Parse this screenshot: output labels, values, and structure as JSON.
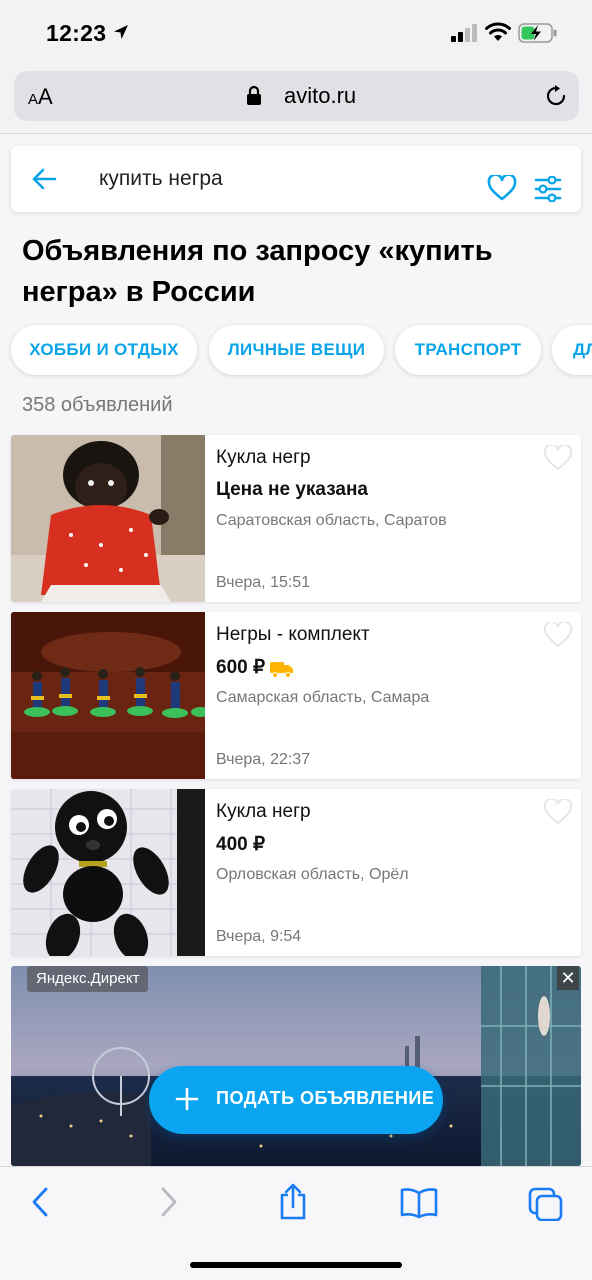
{
  "status_bar": {
    "time": "12:23"
  },
  "browser": {
    "text_size_label_small": "A",
    "text_size_label_large": "A",
    "domain": "avito.ru"
  },
  "search": {
    "query": "купить негра"
  },
  "headline": "Объявления по запросу «купить негра» в России",
  "categories": [
    "ХОББИ И ОТДЫХ",
    "ЛИЧНЫЕ ВЕЩИ",
    "ТРАНСПОРТ",
    "ДЛ"
  ],
  "results_count": "358 объявлений",
  "listings": [
    {
      "title": "Кукла негр",
      "price": "Цена не указана",
      "delivery": false,
      "location": "Саратовская область, Саратов",
      "date": "Вчера, 15:51"
    },
    {
      "title": "Негры - комплект",
      "price": "600 ₽",
      "delivery": true,
      "location": "Самарская область, Самара",
      "date": "Вчера, 22:37"
    },
    {
      "title": "Кукла негр",
      "price": "400 ₽",
      "delivery": false,
      "location": "Орловская область, Орёл",
      "date": "Вчера, 9:54"
    }
  ],
  "ad": {
    "badge": "Яндекс.Директ",
    "close": "✕"
  },
  "post_ad_button": "ПОДАТЬ ОБЪЯВЛЕНИЕ",
  "colors": {
    "accent": "#0aa4e8",
    "fab": "#0aa4f0",
    "delivery": "#ffb400",
    "ios_blue": "#1a7cf5"
  },
  "icons": [
    "location-arrow-icon",
    "signal-icon",
    "wifi-icon",
    "battery-charging-icon",
    "lock-icon",
    "reload-icon",
    "back-arrow-icon",
    "heart-icon",
    "filter-icon",
    "truck-icon",
    "plus-icon",
    "chevron-left-icon",
    "chevron-right-icon",
    "share-icon",
    "bookmarks-icon",
    "tabs-icon"
  ]
}
